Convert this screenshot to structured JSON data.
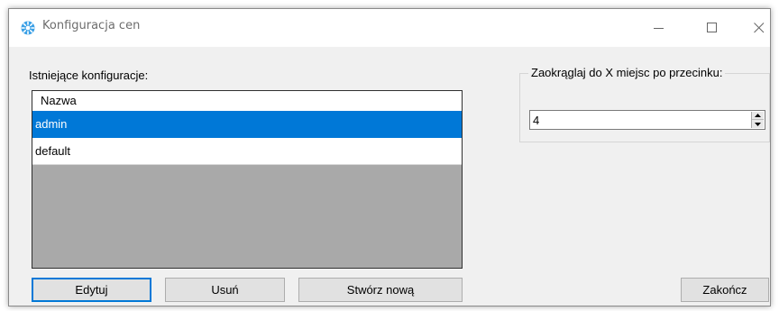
{
  "window": {
    "title": "Konfiguracja cen"
  },
  "titlebar": {
    "minimize_icon": "minimize-icon",
    "maximize_icon": "maximize-icon",
    "close_icon": "close-icon"
  },
  "configs": {
    "label": "Istniejące konfiguracje:",
    "column_header": "Nazwa",
    "rows": [
      {
        "name": "admin",
        "selected": true
      },
      {
        "name": "default",
        "selected": false
      }
    ]
  },
  "rounding": {
    "group_label": "Zaokrąglaj do X miejsc po przecinku:",
    "value": "4"
  },
  "buttons": {
    "edit": "Edytuj",
    "delete": "Usuń",
    "create": "Stwórz nową",
    "close": "Zakończ"
  },
  "colors": {
    "selection": "#0078d7",
    "list_background": "#a9a9a9",
    "window_background": "#f0f0f0"
  }
}
